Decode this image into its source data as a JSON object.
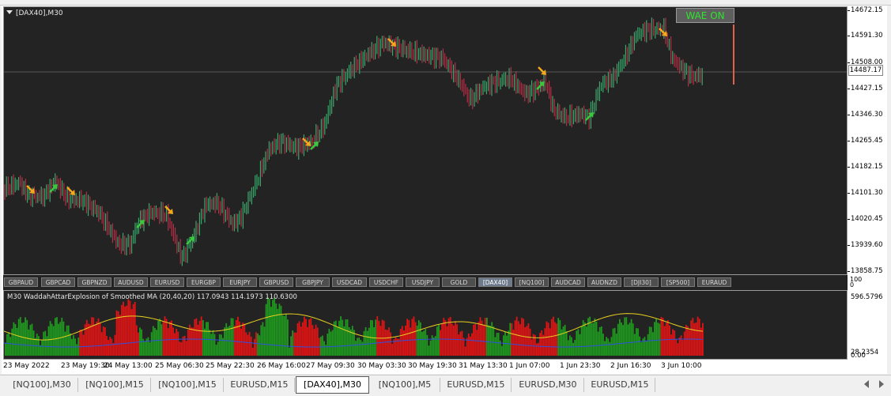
{
  "chart": {
    "title": "[DAX40],M30",
    "badge": "WAE ON",
    "current_price": "14487.17",
    "price_axis": [
      "14672.15",
      "14591.30",
      "14508.00",
      "14427.15",
      "14346.30",
      "14265.45",
      "14182.15",
      "14101.30",
      "14020.45",
      "13939.60",
      "13858.75"
    ],
    "colors": {
      "background": "#232323",
      "bull": "#3cb371",
      "bear": "#c0304a",
      "arrow_sell": "#f4a81c",
      "arrow_buy": "#3cc83c"
    }
  },
  "symbols": [
    "GBPAUD",
    "GBPCAD",
    "GBPNZD",
    "AUDUSD",
    "EURUSD",
    "EURGBP",
    "EURJPY",
    "GBPUSD",
    "GBPJPY",
    "USDCAD",
    "USDCHF",
    "USDJPY",
    "GOLD",
    "[DAX40]",
    "[NQ100]",
    "AUDCAD",
    "AUDNZD",
    "[DJI30]",
    "[SP500]",
    "EURAUD"
  ],
  "active_symbol": "[DAX40]",
  "strip_axis": [
    "100",
    "0"
  ],
  "indicator": {
    "label": "M30  WaddahAttarExplosion of Smoothed MA (20,40,20) 117.0943 114.1973 110.6300",
    "axis": [
      "596.5796",
      "28.2354",
      "0.00"
    ]
  },
  "time_axis": [
    "23 May 2022",
    "23 May 19:30",
    "24 May 13:00",
    "25 May 06:30",
    "25 May 22:30",
    "26 May 16:00",
    "27 May 09:30",
    "30 May 03:30",
    "30 May 19:30",
    "31 May 13:30",
    "1 Jun 07:00",
    "1 Jun 23:30",
    "2 Jun 16:30",
    "3 Jun 10:00"
  ],
  "tabs": [
    "[NQ100],M30",
    "[NQ100],M15",
    "[NQ100],M15",
    "EURUSD,M15",
    "[DAX40],M30",
    "[NQ100],M5",
    "EURUSD,M15",
    "EURUSD,M30",
    "EURUSD,M15"
  ],
  "active_tab": "[DAX40],M30"
}
